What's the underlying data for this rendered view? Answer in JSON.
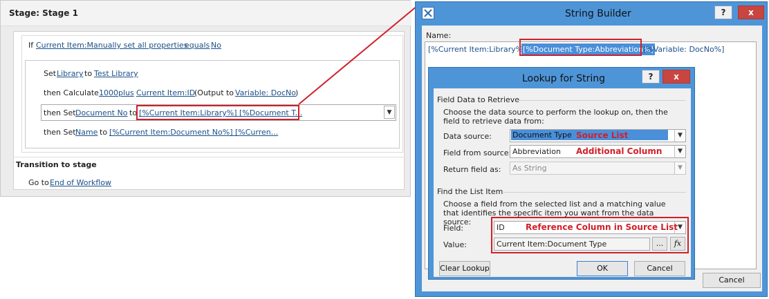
{
  "workflow": {
    "stage_title": "Stage: Stage 1",
    "if_label": "If",
    "if_field": "Current Item:Manually set all properties",
    "if_op": "equals",
    "if_value": "No",
    "set1_prefix": "Set",
    "set1_field": "Library",
    "set1_to": "to",
    "set1_value": "Test Library",
    "calc_prefix": "then Calculate",
    "calc_a": "1000",
    "calc_op": "plus",
    "calc_b": "Current Item:ID",
    "calc_output_prefix": "(Output to",
    "calc_output_var": "Variable: DocNo",
    "calc_output_suffix": ")",
    "set2_prefix": "then Set",
    "set2_field": "Document No",
    "set2_to": "to",
    "set2_value": "[%Current Item:Library%]  [%Document T...",
    "set3_prefix": "then Set",
    "set3_field": "Name",
    "set3_to": "to",
    "set3_value": "[%Current Item:Document No%]  [%Curren...",
    "transition_title": "Transition to stage",
    "goto_prefix": "Go to",
    "goto_target": "End of Workflow"
  },
  "string_builder": {
    "title": "String Builder",
    "help": "?",
    "close": "x",
    "name_label": "Name:",
    "token1": "[%Current Item:Library%]",
    "token2": "[%Document Type:Abbreviation%]",
    "token3": "[%Variable: DocNo%]",
    "cancel": "Cancel"
  },
  "lookup": {
    "title": "Lookup for String",
    "help": "?",
    "close": "x",
    "section1": "Field Data to Retrieve",
    "desc1": "Choose the data source to perform the lookup on, then the field to retrieve data from:",
    "data_source_label": "Data source:",
    "data_source_value": "Document Type",
    "field_from_source_label": "Field from source:",
    "field_from_source_value": "Abbreviation",
    "return_field_label": "Return field as:",
    "return_field_value": "As String",
    "section2": "Find the List Item",
    "desc2": "Choose a field from the selected list and a matching value that identifies the specific item you want from the data source:",
    "field_label": "Field:",
    "field_value": "ID",
    "value_label": "Value:",
    "value_value": "Current Item:Document Type",
    "ellipsis": "...",
    "fx": "fx",
    "clear_lookup": "Clear Lookup",
    "ok": "OK",
    "cancel": "Cancel"
  },
  "annotations": {
    "source_list": "Source List",
    "additional_column": "Additional Column",
    "reference_column": "Reference Column in Source List"
  },
  "colors": {
    "title_bar": "#4e95d8",
    "highlight_red": "#d0202a",
    "selection_blue": "#4a8fd9"
  }
}
